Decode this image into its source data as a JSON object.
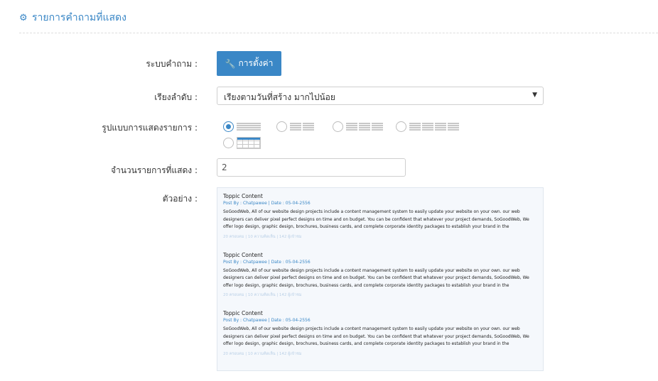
{
  "header": {
    "title": "รายการคำถามที่แสดง",
    "icon": "gear-icon"
  },
  "labels": {
    "question_system": "ระบบคำถาม :",
    "sort": "เรียงลำดับ :",
    "display_format": "รูปแบบการแสดงรายการ :",
    "item_count": "จำนวนรายการที่แสดง :",
    "example": "ตัวอย่าง :"
  },
  "settings_button": {
    "label": "การตั้งค่า",
    "icon": "wrench-icon"
  },
  "sort_select": {
    "value": "เรียงตามวันที่สร้าง มากไปน้อย"
  },
  "display_format": {
    "selected": 1
  },
  "item_count": {
    "value": "2"
  },
  "preview": {
    "items": [
      {
        "title": "Toppic Content",
        "meta": "Post By : Chatpawee  |  Date : 05-04-2556",
        "body": "SoGoodWeb, All of our website design projects include a content management system to easily update your website on your own. our web designers can deliver pixel perfect designs on time and on budget. You can be confident that whatever your project demands, SoGoodWeb, We offer logo design, graphic design, brochures, business cards, and complete corporate identity packages to establish your brand in the marketplace. Helping you to stand out among",
        "footer": "20 ครอบคม  |  10 ความคิดเห็น  |  142 ผู้เข้าชม"
      },
      {
        "title": "Toppic Content",
        "meta": "Post By : Chatpawee  |  Date : 05-04-2556",
        "body": "SoGoodWeb, All of our website design projects include a content management system to easily update your website on your own. our web designers can deliver pixel perfect designs on time and on budget. You can be confident that whatever your project demands, SoGoodWeb, We offer logo design, graphic design, brochures, business cards, and complete corporate identity packages to establish your brand in the marketplace. Helping you to stand out among",
        "footer": "20 ครอบคม  |  10 ความคิดเห็น  |  142 ผู้เข้าชม"
      },
      {
        "title": "Toppic Content",
        "meta": "Post By : Chatpawee  |  Date : 05-04-2556",
        "body": "SoGoodWeb, All of our website design projects include a content management system to easily update your website on your own. our web designers can deliver pixel perfect designs on time and on budget. You can be confident that whatever your project demands, SoGoodWeb, We offer logo design, graphic design, brochures, business cards, and complete corporate identity packages to establish your brand in the marketplace. Helping you to stand out among",
        "footer": "20 ครอบคม  |  10 ความคิดเห็น  |  142 ผู้เข้าชม"
      }
    ]
  },
  "colors": {
    "accent": "#3a87c6"
  }
}
